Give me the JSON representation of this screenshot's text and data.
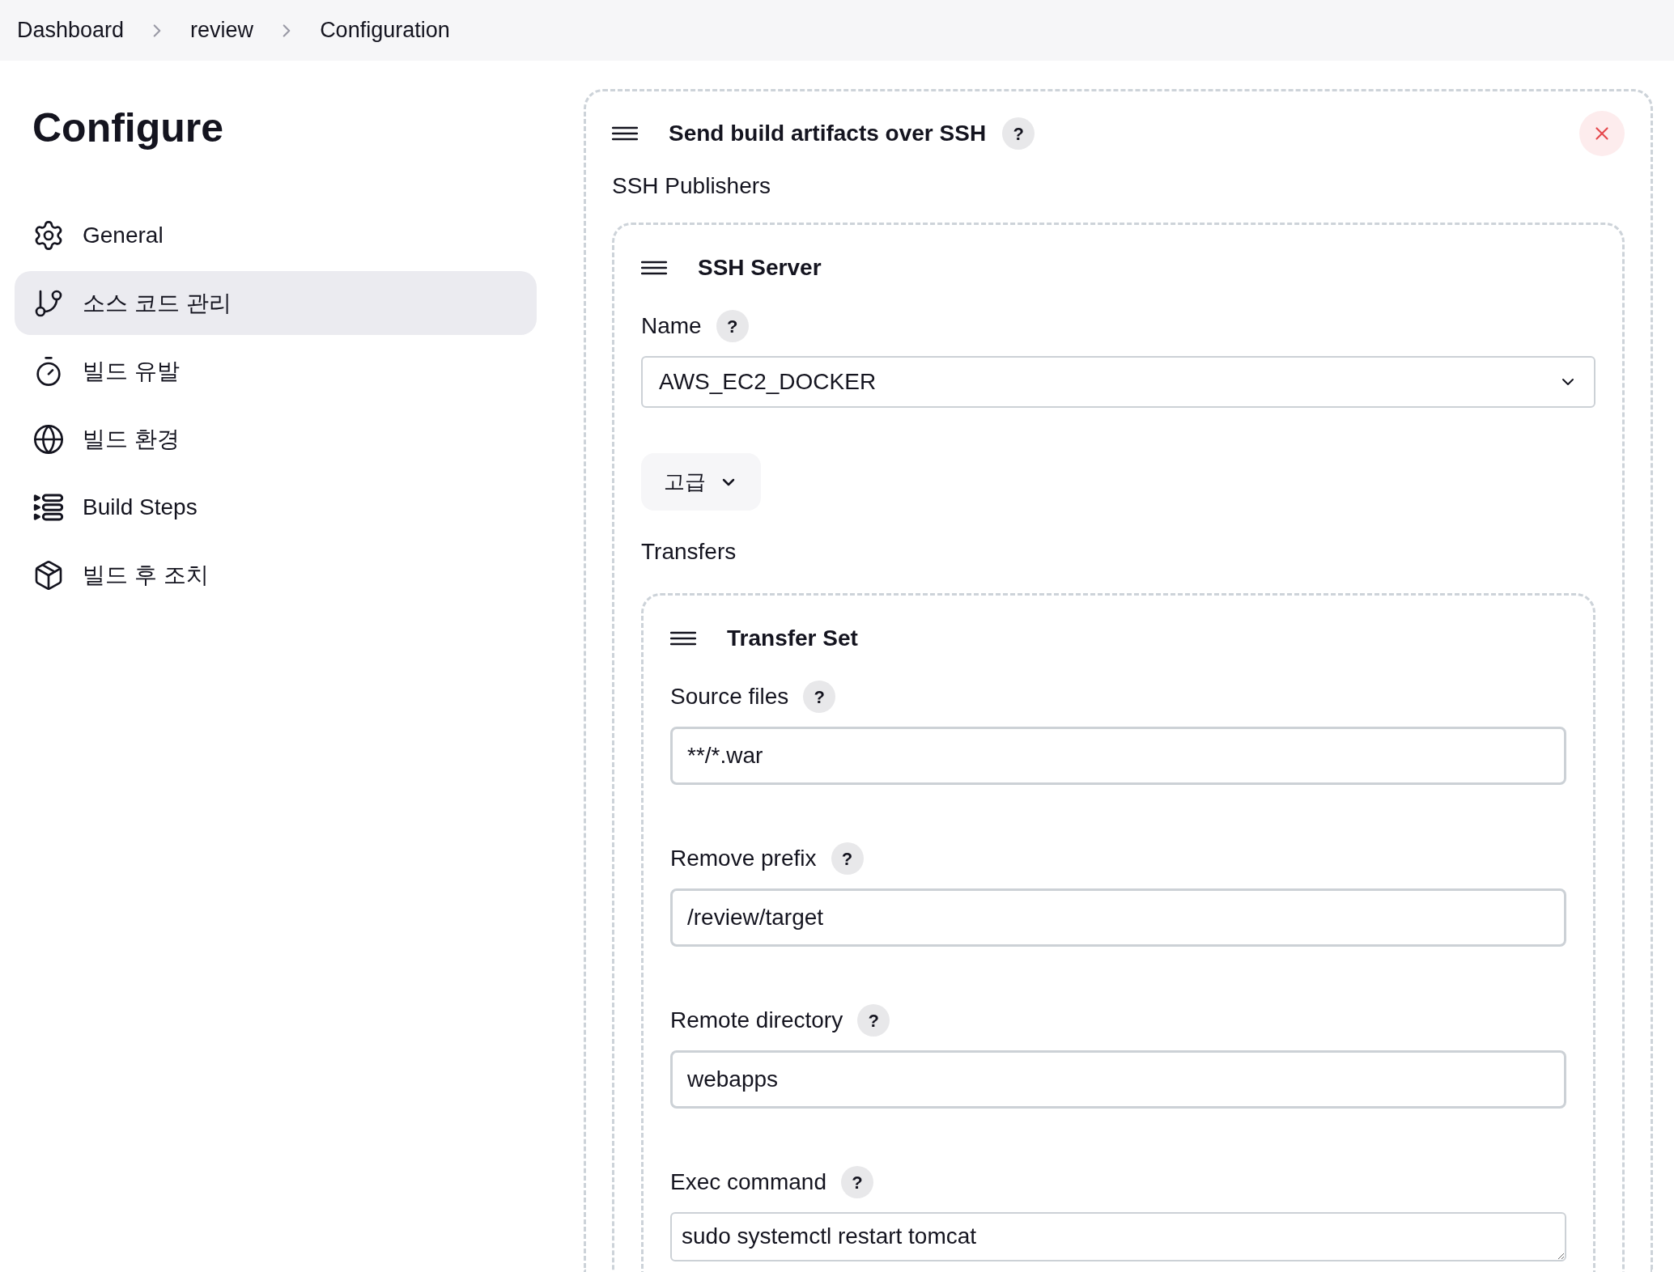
{
  "breadcrumbs": [
    {
      "label": "Dashboard"
    },
    {
      "label": "review"
    },
    {
      "label": "Configuration"
    }
  ],
  "sidebar": {
    "title": "Configure",
    "items": [
      {
        "label": "General",
        "selected": false
      },
      {
        "label": "소스 코드 관리",
        "selected": true
      },
      {
        "label": "빌드 유발",
        "selected": false
      },
      {
        "label": "빌드 환경",
        "selected": false
      },
      {
        "label": "Build Steps",
        "selected": false
      },
      {
        "label": "빌드 후 조치",
        "selected": false
      }
    ]
  },
  "panel": {
    "title": "Send build artifacts over SSH",
    "help": "?",
    "section_label": "SSH Publishers",
    "server": {
      "title": "SSH Server",
      "name_label": "Name",
      "name_help": "?",
      "name_value": "AWS_EC2_DOCKER",
      "advanced_button": "고급",
      "transfers_label": "Transfers",
      "transfer_set": {
        "title": "Transfer Set",
        "fields": [
          {
            "label": "Source files",
            "help": "?",
            "value": "**/*.war",
            "kind": "input"
          },
          {
            "label": "Remove prefix",
            "help": "?",
            "value": "/review/target",
            "kind": "input"
          },
          {
            "label": "Remote directory",
            "help": "?",
            "value": "webapps",
            "kind": "input"
          },
          {
            "label": "Exec command",
            "help": "?",
            "value": "sudo systemctl restart tomcat",
            "kind": "textarea"
          }
        ]
      }
    }
  }
}
